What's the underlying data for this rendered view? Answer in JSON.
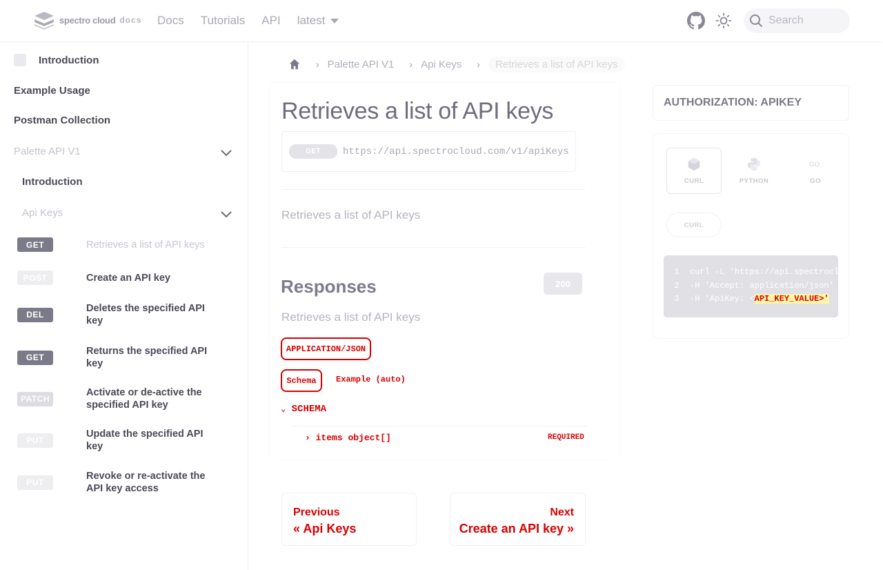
{
  "brand": {
    "name": "spectro cloud",
    "product": "docs"
  },
  "nav": {
    "links": [
      "Docs",
      "Tutorials",
      "API"
    ],
    "version": "latest",
    "search_placeholder": "Search"
  },
  "sidebar": {
    "top_items": [
      "Introduction",
      "Example Usage",
      "Postman Collection"
    ],
    "section": "Palette API V1",
    "section_intro": "Introduction",
    "group": "Api Keys",
    "endpoints": [
      {
        "method": "GET",
        "label": "Retrieves a list of API keys",
        "color": "#7a7a88",
        "active": true
      },
      {
        "method": "POST",
        "label": "Create an API key",
        "color": "#eeeef1",
        "active": false
      },
      {
        "method": "DEL",
        "label": "Deletes the specified API key",
        "color": "#7a7a88",
        "active": false
      },
      {
        "method": "GET",
        "label": "Returns the specified API key",
        "color": "#7a7a88",
        "active": false
      },
      {
        "method": "PATCH",
        "label": "Activate or de-active the specified API key",
        "color": "#dcdce2",
        "active": false
      },
      {
        "method": "PUT",
        "label": "Update the specified API key",
        "color": "#eeeef1",
        "active": false
      },
      {
        "method": "PUT",
        "label": "Revoke or re-activate the API key access",
        "color": "#eeeef1",
        "active": false
      }
    ]
  },
  "breadcrumb": {
    "items": [
      "Palette API V1",
      "Api Keys"
    ],
    "current": "Retrieves a list of API keys"
  },
  "main": {
    "title": "Retrieves a list of API keys",
    "method": "GET",
    "url": "https://api.spectrocloud.com/v1/apiKeys",
    "description": "Retrieves a list of API keys",
    "responses_title": "Responses",
    "response_code": "200",
    "response_desc": "Retrieves a list of API keys",
    "content_type": "APPLICATION/JSON",
    "tab_schema": "Schema",
    "tab_example": "Example (auto)",
    "schema_heading": "SCHEMA",
    "schema_field": "items",
    "schema_type": "object[]",
    "schema_required": "REQUIRED"
  },
  "pager": {
    "prev_label": "Previous",
    "prev_title": "« Api Keys",
    "next_label": "Next",
    "next_title": "Create an API key »"
  },
  "right": {
    "auth": "AUTHORIZATION: APIKEY",
    "tabs": [
      "CURL",
      "PYTHON",
      "GO"
    ],
    "subtab": "CURL",
    "code": [
      {
        "n": "1",
        "text": "curl -L 'https://api.spectrocl",
        "hl": ""
      },
      {
        "n": "2",
        "text": "-H 'Accept: application/json' \\",
        "hl": ""
      },
      {
        "n": "3",
        "text": "-H 'ApiKey: <",
        "hl": "API_KEY_VALUE>'"
      }
    ]
  }
}
